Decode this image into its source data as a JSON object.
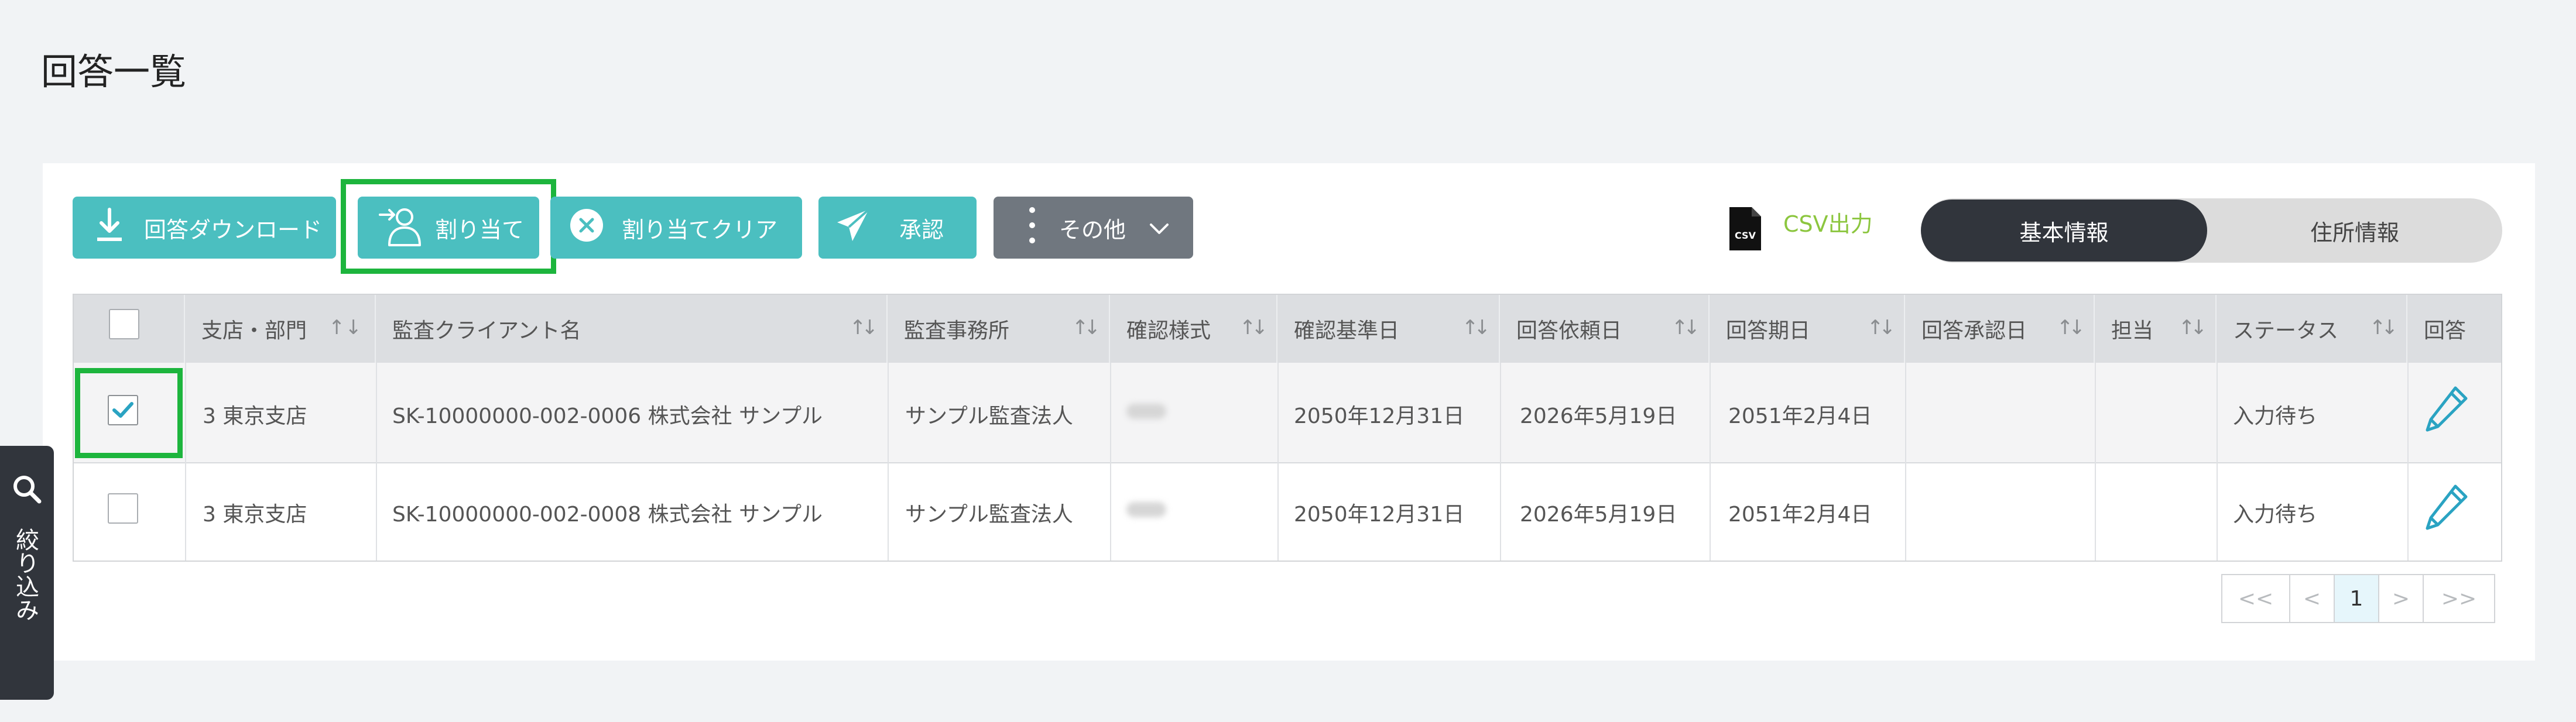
{
  "page": {
    "title": "回答一覧"
  },
  "toolbar": {
    "download_label": "回答ダウンロード",
    "assign_label": "割り当て",
    "assign_clear_label": "割り当てクリア",
    "approve_label": "承認",
    "other_label": "その他"
  },
  "csv": {
    "label": "CSV出力",
    "icon_text": "CSV"
  },
  "view_toggle": {
    "basic": "基本情報",
    "address": "住所情報",
    "selected": "basic"
  },
  "table": {
    "headers": [
      "支店・部門",
      "監査クライアント名",
      "監査事務所",
      "確認様式",
      "確認基準日",
      "回答依頼日",
      "回答期日",
      "回答承認日",
      "担当",
      "ステータス",
      "回答"
    ],
    "rows": [
      {
        "checked": true,
        "branch": "3 東京支店",
        "client": "SK-10000000-002-0006 株式会社 サンプル",
        "firm": "サンプル監査法人",
        "base_date": "2050年12月31日",
        "request_date": "2026年5月19日",
        "due_date": "2051年2月4日",
        "approval_date": "",
        "assignee": "",
        "status": "入力待ち"
      },
      {
        "checked": false,
        "branch": "3 東京支店",
        "client": "SK-10000000-002-0008 株式会社 サンプル",
        "firm": "サンプル監査法人",
        "base_date": "2050年12月31日",
        "request_date": "2026年5月19日",
        "due_date": "2051年2月4日",
        "approval_date": "",
        "assignee": "",
        "status": "入力待ち"
      }
    ]
  },
  "pagination": {
    "first": "<<",
    "prev": "<",
    "current": "1",
    "next": ">",
    "last": ">>"
  },
  "filter": {
    "label": "絞り込み"
  },
  "colors": {
    "accent": "#4bbfc0",
    "dark": "#31353c",
    "highlight": "#1db53d",
    "csv_green": "#8cc63f",
    "other_button": "#70777f"
  },
  "icons": [
    "download-icon",
    "assign-user-icon",
    "clear-icon",
    "send-icon",
    "more-vertical-icon",
    "chevron-down-icon",
    "csv-file-icon",
    "checkmark-icon",
    "edit-pencil-icon",
    "search-icon",
    "sort-icon"
  ]
}
